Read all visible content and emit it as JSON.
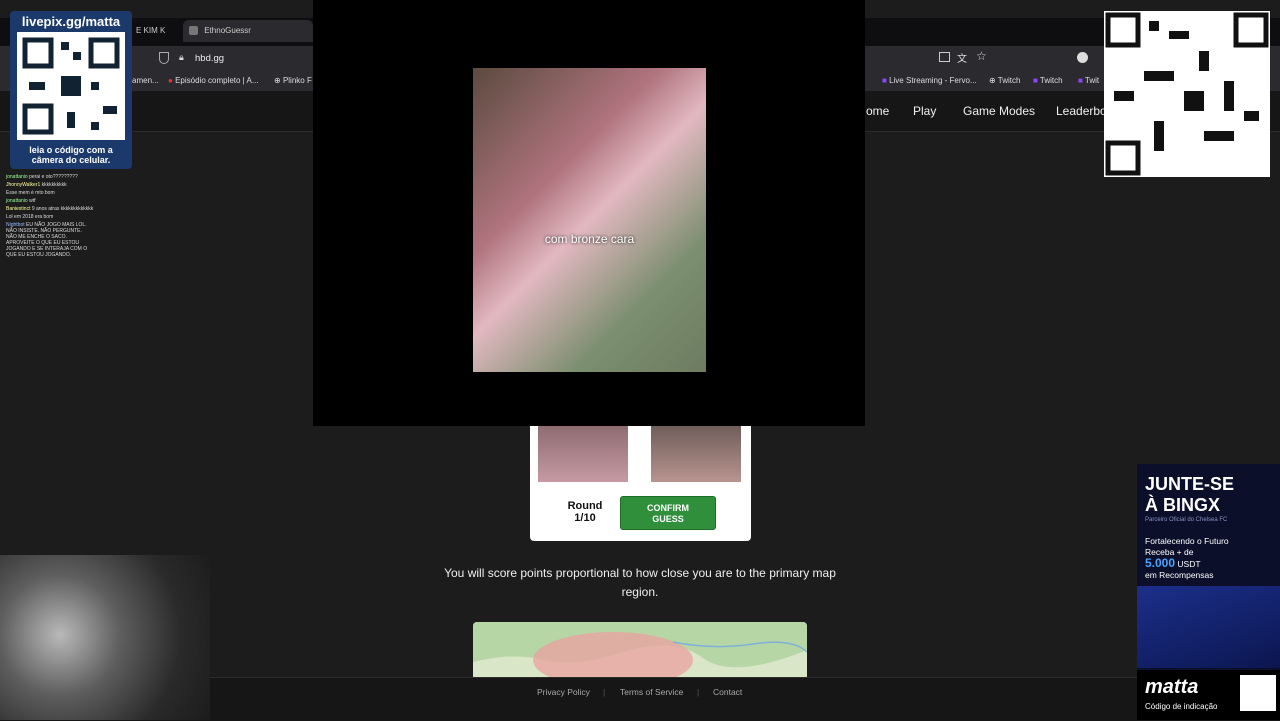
{
  "browser": {
    "tabs": [
      {
        "label": "E KIM K"
      },
      {
        "label": "EthnoGuessr"
      }
    ],
    "url": "hbd.gg",
    "bookmarks": [
      {
        "label": "amen..."
      },
      {
        "label": "Episódio completo | A..."
      },
      {
        "label": "Plinko F"
      },
      {
        "label": "Live Streaming - Fervo..."
      },
      {
        "label": "Twitch"
      },
      {
        "label": "Twitch"
      },
      {
        "label": "Twit"
      }
    ]
  },
  "site_nav": {
    "items": [
      {
        "label": "ome"
      },
      {
        "label": "Play"
      },
      {
        "label": "Game Modes"
      },
      {
        "label": "Leaderboa"
      }
    ]
  },
  "qr_left": {
    "title": "livepix.gg/matta",
    "caption": "leia o código com a câmera do celular."
  },
  "chat": {
    "messages": [
      {
        "user": "jonattanio",
        "text": "perai e oto?????????"
      },
      {
        "user": "JhonnyWalker1",
        "text": "kkkkkkkkkk"
      },
      {
        "user": "",
        "text": "Esse mem é mto bom"
      },
      {
        "user": "jonattanio",
        "text": "wtf"
      },
      {
        "user": "Baniestinct",
        "text": "9 anos atras kkkkkkkkkkkkk"
      },
      {
        "user": "",
        "text": "Lol em 2018 era bom"
      },
      {
        "user": "Nightbot",
        "text": "EU NÃO JOGO MAIS LOL. NÃO INSISTE. NÃO PERGUNTE. NÃO ME ENCHE O SACO. APROVEITE O QUE EU ESTOU JOGANDO E SE INTERAJA COM O QUE EU ESTOU JOGANDO."
      }
    ]
  },
  "video": {
    "caption": "com bronze cara"
  },
  "game": {
    "round_label": "Round",
    "round_value": "1/10",
    "confirm_line1": "CONFIRM",
    "confirm_line2": "GUESS",
    "instructions": "You will score points proportional to how close you are to the primary map region."
  },
  "footer": {
    "links": [
      {
        "label": "Privacy Policy"
      },
      {
        "label": "Terms of Service"
      },
      {
        "label": "Contact"
      }
    ],
    "separator": "|"
  },
  "ad": {
    "headline1": "JUNTE-SE",
    "headline2": "À BINGX",
    "sub": "Parceiro Oficial do Chelsea FC",
    "line1": "Fortalecendo o Futuro",
    "line2": "Receba + de",
    "amount": "5.000",
    "currency": "USDT",
    "line3": "em Recompensas",
    "brand": "matta",
    "brand_sub": "Código de indicação"
  },
  "colors": {
    "confirm_green": "#2f8f3a",
    "qr_panel_blue": "#1b3a6b",
    "ad_blue": "#0b0f2a"
  }
}
